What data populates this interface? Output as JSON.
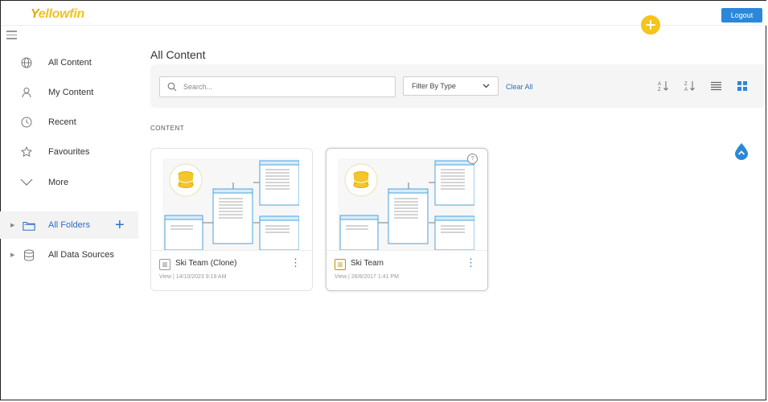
{
  "brand": {
    "logo_first": "Y",
    "logo_rest": "ellowfin",
    "accent": "#f6c41a",
    "primary": "#2b88d8"
  },
  "header": {
    "logout_label": "Logout",
    "add_icon": "plus-icon"
  },
  "sidebar": {
    "items": [
      {
        "label": "All Content",
        "icon": "globe-icon"
      },
      {
        "label": "My Content",
        "icon": "user-icon"
      },
      {
        "label": "Recent",
        "icon": "clock-icon"
      },
      {
        "label": "Favourites",
        "icon": "star-icon"
      },
      {
        "label": "More",
        "icon": "chevron-down-icon"
      },
      {
        "label": "All Folders",
        "icon": "folder-icon"
      },
      {
        "label": "All Data Sources",
        "icon": "database-icon"
      }
    ]
  },
  "main": {
    "title": "All Content",
    "search": {
      "placeholder": "Search..."
    },
    "filter": {
      "label": "Filter By Type"
    },
    "clear_all": "Clear All",
    "section_label": "CONTENT",
    "cards": [
      {
        "title": "Ski Team (Clone)",
        "meta": "View | 14/10/2023 9:19 AM"
      },
      {
        "title": "Ski Team",
        "meta": "View | 26/6/2017 1:41 PM"
      }
    ]
  }
}
